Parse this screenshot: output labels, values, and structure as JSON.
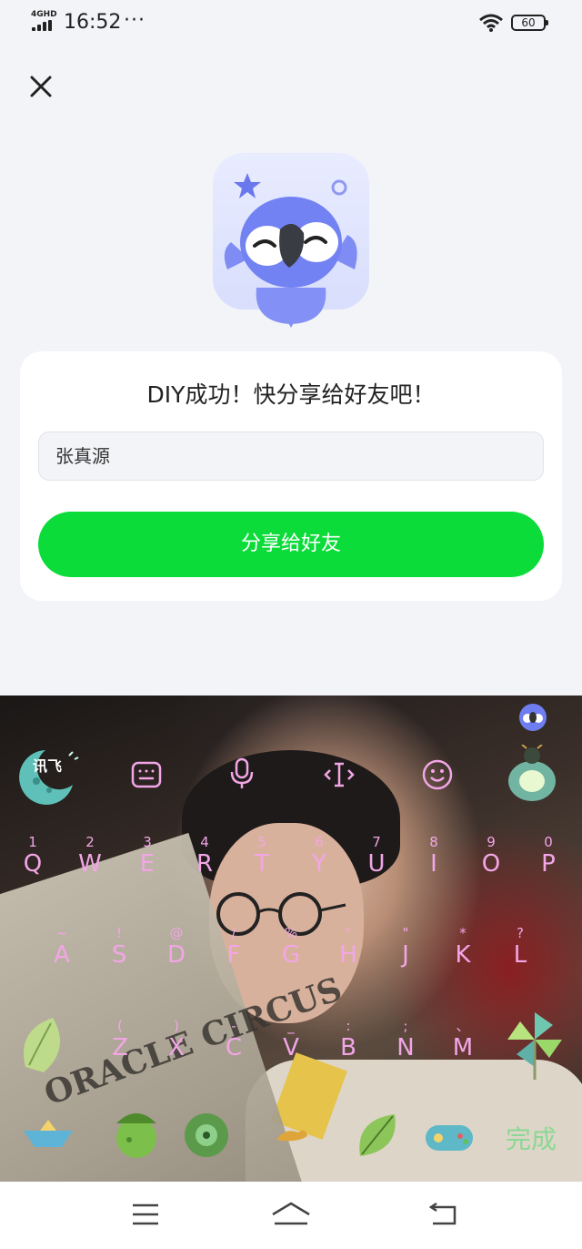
{
  "status_bar": {
    "network": "4GHD",
    "time": "16:52",
    "more": "···",
    "battery": "60"
  },
  "dialog": {
    "title": "DIY成功！快分享给好友吧！",
    "name_value": "张真源",
    "share_button": "分享给好友"
  },
  "keyboard": {
    "brand": "讯飞",
    "done_label": "完成",
    "toolbar_icons": [
      "keyboard-icon",
      "microphone-icon",
      "cursor-icon",
      "emoji-icon"
    ],
    "row1": [
      {
        "main": "Q",
        "sub": "1"
      },
      {
        "main": "W",
        "sub": "2"
      },
      {
        "main": "E",
        "sub": "3"
      },
      {
        "main": "R",
        "sub": "4"
      },
      {
        "main": "T",
        "sub": "5"
      },
      {
        "main": "Y",
        "sub": "6"
      },
      {
        "main": "U",
        "sub": "7"
      },
      {
        "main": "I",
        "sub": "8"
      },
      {
        "main": "O",
        "sub": "9"
      },
      {
        "main": "P",
        "sub": "0"
      }
    ],
    "row2": [
      {
        "main": "A",
        "sub": "~"
      },
      {
        "main": "S",
        "sub": "!"
      },
      {
        "main": "D",
        "sub": "@"
      },
      {
        "main": "F",
        "sub": "/"
      },
      {
        "main": "G",
        "sub": "%"
      },
      {
        "main": "H",
        "sub": "\""
      },
      {
        "main": "J",
        "sub": "\""
      },
      {
        "main": "K",
        "sub": "*"
      },
      {
        "main": "L",
        "sub": "?"
      }
    ],
    "row3": [
      {
        "main": "Z",
        "sub": "("
      },
      {
        "main": "X",
        "sub": ")"
      },
      {
        "main": "C",
        "sub": "-"
      },
      {
        "main": "V",
        "sub": "_"
      },
      {
        "main": "B",
        "sub": ":"
      },
      {
        "main": "N",
        "sub": ";"
      },
      {
        "main": "M",
        "sub": "、"
      }
    ]
  },
  "photo": {
    "newspaper_text": "ORACLE CIRCUS"
  },
  "colors": {
    "accent_green": "#0bdc3a",
    "key_text": "#f2a6e6",
    "mascot_blue": "#6e7df0"
  }
}
